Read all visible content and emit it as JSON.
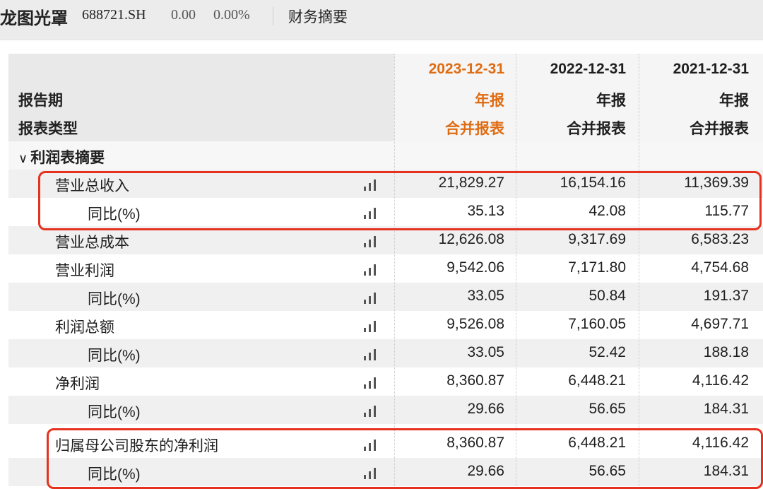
{
  "header": {
    "stock_name": "龙图光罩",
    "stock_code": "688721.SH",
    "price": "0.00",
    "change_pct": "0.00%",
    "section_tab": "财务摘要"
  },
  "table": {
    "columns": [
      {
        "date": "2023-12-31",
        "period": "年报",
        "type": "合并报表"
      },
      {
        "date": "2022-12-31",
        "period": "年报",
        "type": "合并报表"
      },
      {
        "date": "2021-12-31",
        "period": "年报",
        "type": "合并报表"
      }
    ],
    "head_labels": {
      "period_label": "报告期",
      "type_label": "报表类型"
    },
    "section": {
      "chevron": "∨",
      "label": "利润表摘要"
    },
    "rows": [
      {
        "label": "营业总收入",
        "values": [
          "21,829.27",
          "16,154.16",
          "11,369.39"
        ]
      },
      {
        "label": "同比(%)",
        "values": [
          "35.13",
          "42.08",
          "115.77"
        ]
      },
      {
        "label": "营业总成本",
        "values": [
          "12,626.08",
          "9,317.69",
          "6,583.23"
        ]
      },
      {
        "label": "营业利润",
        "values": [
          "9,542.06",
          "7,171.80",
          "4,754.68"
        ]
      },
      {
        "label": "同比(%)",
        "values": [
          "33.05",
          "50.84",
          "191.37"
        ]
      },
      {
        "label": "利润总额",
        "values": [
          "9,526.08",
          "7,160.05",
          "4,697.71"
        ]
      },
      {
        "label": "同比(%)",
        "values": [
          "33.05",
          "52.42",
          "188.18"
        ]
      },
      {
        "label": "净利润",
        "values": [
          "8,360.87",
          "6,448.21",
          "4,116.42"
        ]
      },
      {
        "label": "同比(%)",
        "values": [
          "29.66",
          "56.65",
          "184.31"
        ]
      },
      {
        "label": "归属母公司股东的净利润",
        "values": [
          "8,360.87",
          "6,448.21",
          "4,116.42"
        ]
      },
      {
        "label": "同比(%)",
        "values": [
          "29.66",
          "56.65",
          "184.31"
        ]
      }
    ]
  },
  "colors": {
    "accent": "#e06c12",
    "highlight": "#e6311f"
  },
  "icons": {
    "row_chart": "bar-chart-icon"
  }
}
